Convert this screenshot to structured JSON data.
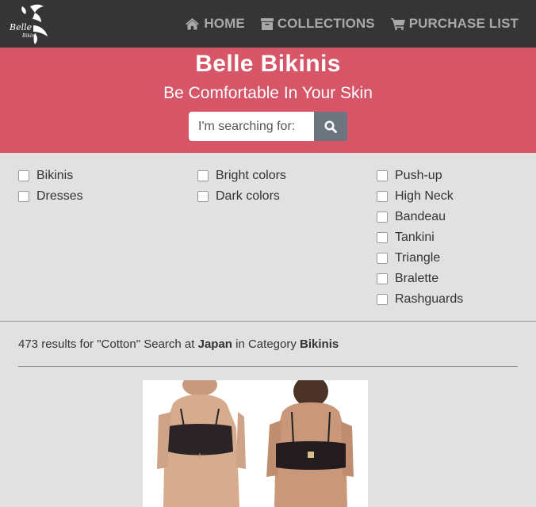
{
  "nav": {
    "logo_text": "Belle Bikini",
    "links": [
      {
        "label": "HOME",
        "icon": "home-icon"
      },
      {
        "label": "COLLECTIONS",
        "icon": "archive-icon"
      },
      {
        "label": "PURCHASE LIST",
        "icon": "cart-icon"
      }
    ]
  },
  "hero": {
    "title": "Belle Bikinis",
    "subtitle": "Be Comfortable In Your Skin",
    "search_placeholder": "I'm searching for:"
  },
  "filters": {
    "col1": [
      "Bikinis",
      "Dresses"
    ],
    "col2": [
      "Bright colors",
      "Dark colors"
    ],
    "col3": [
      "Push-up",
      "High Neck",
      "Bandeau",
      "Tankini",
      "Triangle",
      "Bralette",
      "Rashguards"
    ]
  },
  "results": {
    "count_text": "473 results for \"Cotton\" Search at ",
    "location": "Japan",
    "middle": " in Category ",
    "category": "Bikinis"
  },
  "colors": {
    "navbar": "#353535",
    "hero": "#d65566",
    "background": "#e1e1e1",
    "search_button": "#6c757d"
  }
}
